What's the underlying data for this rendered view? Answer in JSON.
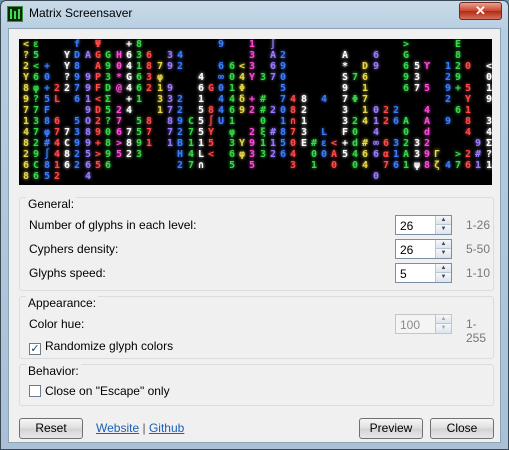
{
  "window": {
    "title": "Matrix Screensaver",
    "close_glyph": "✕"
  },
  "preview": {
    "columns": [
      {
        "text": "<\n?\n2\nY\n8\n9\n7\n1\n4\n8\n2\n6\n8",
        "color": "#e8d84a"
      },
      {
        "text": "ε\n5\n<\n6\nφ\n?\n7\n3\n7\n2\n9\nC\n6",
        "color": "#38d84a"
      },
      {
        "text": "\n\n+\n0\n+\n5\nF\n8\nφ\n#\n∫\n8\n5",
        "color": "#3e7cff"
      },
      {
        "text": "\n\n\n\n2\nL\n\n6\n7\n4\n4\n1\n2",
        "color": "#ff4a4a"
      },
      {
        "text": "\nY\nY\n?\n2\n\n\n\n7\nC\n8\n6",
        "color": "#ffffff"
      },
      {
        "text": "f\nD\n8\n9\n7\n6\n\n5\n3\n9\n2\n2",
        "color": "#3e7cff"
      },
      {
        "text": "\nA\n\n9\n9\n1\n9\nO\n8\n9\n5\n6\n4",
        "color": "#9a7cff"
      },
      {
        "text": "Ψ\nG\nA\nP\nF\n<\nD\n2\n9\n+\n>\n5",
        "color": "#ff4a4a"
      },
      {
        "text": "\nG\n9\n3\nD\nΣ\n5\n?\n0\n8\n9\n6",
        "color": "#38d84a"
      },
      {
        "text": "\nH\n0\n*\n@\n\n2\n7\n6\n>\n5",
        "color": "#ff4ad8"
      },
      {
        "text": "+\n6\n4\nG\n4\n+\n4\n\n7\n8\n2",
        "color": "#ffffff"
      },
      {
        "text": "8\n3\n1\n6\n6\n1\n\n5\n5\n9\n3",
        "color": "#38d84a"
      },
      {
        "text": "\n6\n8\n3\n2\n\n\n8\n7\n1",
        "color": "#ff4a4a"
      },
      {
        "text": "\n\n7\nφ\n1\n3\n1",
        "color": "#e8d84a"
      },
      {
        "text": "\n3\n9\n\n9\n3\n7\n8\n7\n1",
        "color": "#9a7cff"
      },
      {
        "text": "\n4\n2\n\n\n2\n2\n9\n2\nB\nH\n2",
        "color": "#3e7cff"
      },
      {
        "text": "\n\n\n\n\n\n\nC\n7\n1\n4\n7",
        "color": "#38d84a"
      },
      {
        "text": "\n\n\n4\n6\n1\n5\n5\n5\n1\nL\n∩",
        "color": "#ffffff"
      },
      {
        "text": "\n\n\n\nG\n\n8\n∫\nY\n5\n<",
        "color": "#ff4a4a"
      },
      {
        "text": "9\n\n6\n∞\n0\n4\n4\nU",
        "color": "#3e7cff"
      },
      {
        "text": "\n\n6\n0\n1\n4\n6\n1\nφ\n3\n6\n5",
        "color": "#38d84a"
      },
      {
        "text": "\n\n<\n4\nΦ\nδ\n9\n\n\nY\nφ",
        "color": "#e8d84a"
      },
      {
        "text": "1\n3\n3\nY\n\n+\n2\n\n2\n9\n3\n5",
        "color": "#ff4ad8"
      },
      {
        "text": "\n\n\n3\n\n#\n#\n0\nξ\n1\n3",
        "color": "#38d84a"
      },
      {
        "text": "∫\nA\n6\n7\n\n\n2\n\n#\n1\n2",
        "color": "#9a7cff"
      },
      {
        "text": "\n2\n9\n0\n5\n7\n0\n1\n8\n5\n6",
        "color": "#3e7cff"
      },
      {
        "text": "\n\n\n\n\n4\n8\n∩\n7\n0\n4\n3",
        "color": "#ff4a4a"
      },
      {
        "text": "\n\n\n\n\n8\n2\n1\n3\nE",
        "color": "#ffffff"
      },
      {
        "text": "\n\n\n\n\n\n\n\n\n#\n0\n1",
        "color": "#38d84a"
      },
      {
        "text": "\n\n\n\n\n4\n\n\nL\nε\n0",
        "color": "#3e7cff"
      },
      {
        "text": "\n\n\n\n\n\n\n\n\n<\nA\n0",
        "color": "#ff4a4a"
      },
      {
        "text": "\nA\n*\nS\n9\n7\n3\n3\nF\n+\n5",
        "color": "#ffffff"
      },
      {
        "text": "\n\n\n7\n\nΦ\n\n2\n0\nd\n4\n0",
        "color": "#38d84a"
      },
      {
        "text": "\n\nD\n6\n1\n7\n1\n4\n\n#\n6\n4",
        "color": "#e8d84a"
      },
      {
        "text": "\n6\n9\n\n\n\n0\n1\n4\n∞\n6\n\n0",
        "color": "#9a7cff"
      },
      {
        "text": "\n\n\n\n\n\n2\n2\n\n6\nα\n7",
        "color": "#ff4a4a"
      },
      {
        "text": "\n\n\n\n\n\n2\n6\n\n3\n1\n6",
        "color": "#3e7cff"
      },
      {
        "text": ">\nG\n6\n9\n6\n\n\nA\n0\n2\nA\n1",
        "color": "#38d84a"
      },
      {
        "text": "\n\n5\n3\n7\n\n\n\n\n3\n3\nψ",
        "color": "#ffffff"
      },
      {
        "text": "\n\nϒ\n\n5\n\n4\nA\nd\n2\n9\n8",
        "color": "#ff4ad8"
      },
      {
        "text": "\n\n\n\n\n\n\n\n\n\nΓ\nζ",
        "color": "#e8d84a"
      },
      {
        "text": "\n\n1\n2\n9\n2\n\n9\n\n\n\n4",
        "color": "#3e7cff"
      },
      {
        "text": "Ε\n8\n2\n9\n+\n\n6\n\n\n\n>\n7",
        "color": "#38d84a"
      },
      {
        "text": "\n\n0\n\n5\nY\n1\n8\n4\n\n2\n6",
        "color": "#ff4a4a"
      },
      {
        "text": "\n\n\n\n\n\n\n\n\n9\n#\n1",
        "color": "#9a7cff"
      },
      {
        "text": "\n\n<\n0\n1\n9\n\n3\n4\nΣ\n?\n1",
        "color": "#ffffff"
      }
    ]
  },
  "general": {
    "title": "General:",
    "rows": [
      {
        "label": "Number of glyphs in each level:",
        "value": "26",
        "range": "1-26"
      },
      {
        "label": "Cyphers density:",
        "value": "26",
        "range": "5-50"
      },
      {
        "label": "Glyphs speed:",
        "value": "5",
        "range": "1-10"
      }
    ]
  },
  "appearance": {
    "title": "Appearance:",
    "hue_label": "Color hue:",
    "hue_value": "100",
    "hue_range": "1-255",
    "randomize_label": "Randomize glyph colors",
    "randomize_checked": true
  },
  "behavior": {
    "title": "Behavior:",
    "escape_label": "Close on \"Escape\" only",
    "escape_checked": false
  },
  "buttons": {
    "reset": "Reset",
    "website": "Website",
    "separator": "|",
    "github": "Github",
    "preview": "Preview",
    "close": "Close"
  },
  "glyphs": {
    "up": "▲",
    "down": "▼",
    "check": "✓"
  }
}
